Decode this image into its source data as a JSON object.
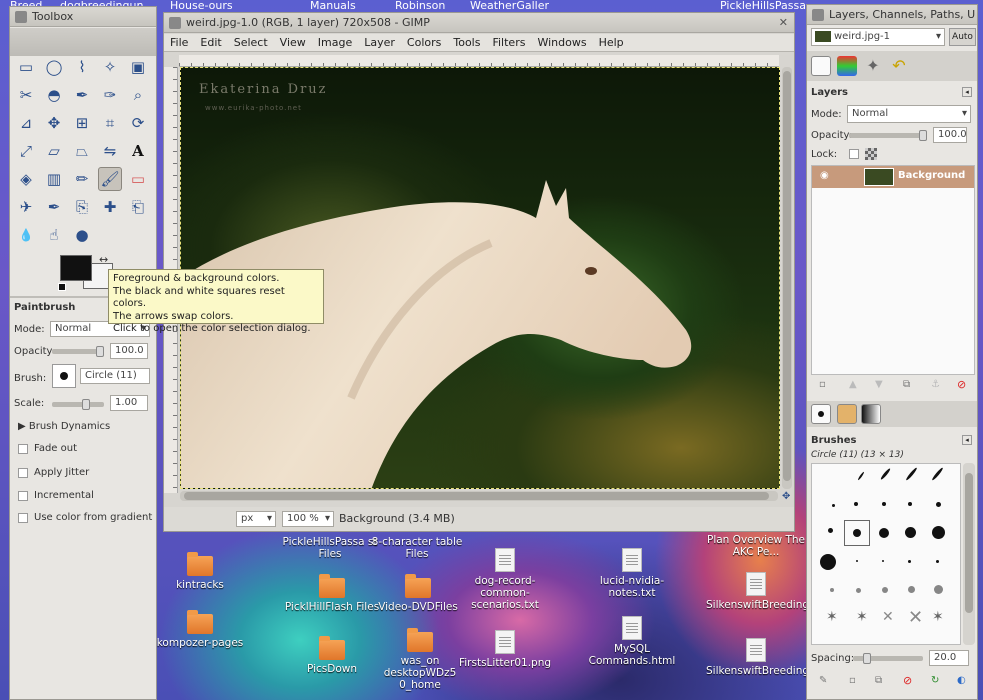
{
  "desktop": {
    "top_strip": [
      "Breed",
      "dogbreedingun",
      "House-ours",
      "Manuals",
      "Robinson",
      "WeatherGaller",
      "PickleHillsPassa"
    ],
    "icons": [
      {
        "label": "kintracks",
        "type": "folder"
      },
      {
        "label": "kompozer-pages",
        "type": "folder"
      },
      {
        "label": "PickleHillsPassa st Files",
        "type": "folder"
      },
      {
        "label": "8-character table Files",
        "type": "folder"
      },
      {
        "label": "PicklHillFlash Files",
        "type": "folder"
      },
      {
        "label": "Video-DVDFiles",
        "type": "folder"
      },
      {
        "label": "dog-record-common-scenarios.txt",
        "type": "doc"
      },
      {
        "label": "lucid-nvidia-notes.txt",
        "type": "doc"
      },
      {
        "label": "PicsDown",
        "type": "folder"
      },
      {
        "label": "was_on desktopWDz5 0_home",
        "type": "folder"
      },
      {
        "label": "FirstsLitter01.png",
        "type": "doc"
      },
      {
        "label": "MySQL Commands.html",
        "type": "doc"
      },
      {
        "label": "Plan Overview The AKC Pe...",
        "type": "doc"
      },
      {
        "label": "SilkenswiftBreedings.csv",
        "type": "doc"
      },
      {
        "label": "SilkenswiftBreedingsListFromAKC.txt",
        "type": "doc"
      }
    ]
  },
  "toolbox": {
    "title": "Toolbox",
    "tools": [
      "rect-select",
      "ellipse-select",
      "free-select",
      "fuzzy-select",
      "color-select",
      "scissors",
      "foreground-select",
      "paths",
      "color-picker",
      "zoom",
      "measure",
      "move",
      "align",
      "crop",
      "rotate",
      "scale",
      "shear",
      "perspective",
      "flip",
      "text",
      "bucket-fill",
      "blend",
      "pencil",
      "paintbrush",
      "eraser",
      "airbrush",
      "ink",
      "clone",
      "heal",
      "perspective-clone",
      "blur",
      "smudge",
      "dodge-burn"
    ],
    "colors": {
      "foreground": "#111111",
      "background": "#f4f4f4"
    },
    "options_title": "Paintbrush",
    "mode_label": "Mode:",
    "mode_value": "Normal",
    "opacity_label": "Opacity",
    "opacity_value": "100.0",
    "opacity_fraction": 1.0,
    "brush_label": "Brush:",
    "brush_value": "Circle (11)",
    "scale_label": "Scale:",
    "scale_value": "1.00",
    "dynamics_label": "Brush Dynamics",
    "checks": [
      "Fade out",
      "Apply Jitter",
      "Incremental",
      "Use color from gradient"
    ]
  },
  "tooltip": {
    "lines": [
      "Foreground & background colors.",
      "The black and white squares reset colors.",
      "The arrows swap colors.",
      "Click to open the color selection dialog."
    ]
  },
  "image_window": {
    "title": "weird.jpg-1.0 (RGB, 1 layer) 720x508 - GIMP",
    "menu": [
      "File",
      "Edit",
      "Select",
      "View",
      "Image",
      "Layer",
      "Colors",
      "Tools",
      "Filters",
      "Windows",
      "Help"
    ],
    "watermark_name": "Ekaterina Druz",
    "watermark_url": "www.eurika-photo.net",
    "status": {
      "unit": "px",
      "zoom": "100 %",
      "info": "Background (3.4 MB)"
    }
  },
  "layers_dock": {
    "title": "Layers, Channels, Paths, U",
    "image_select": "weird.jpg-1",
    "auto_label": "Auto",
    "layers_title": "Layers",
    "mode_label": "Mode:",
    "mode_value": "Normal",
    "opacity_label": "Opacity:",
    "opacity_value": "100.0",
    "opacity_fraction": 1.0,
    "lock_label": "Lock:",
    "layer_name": "Background",
    "brushes_title": "Brushes",
    "brush_current": "Circle (11) (13 × 13)",
    "spacing_label": "Spacing:",
    "spacing_value": "20.0",
    "spacing_fraction": 0.2
  }
}
